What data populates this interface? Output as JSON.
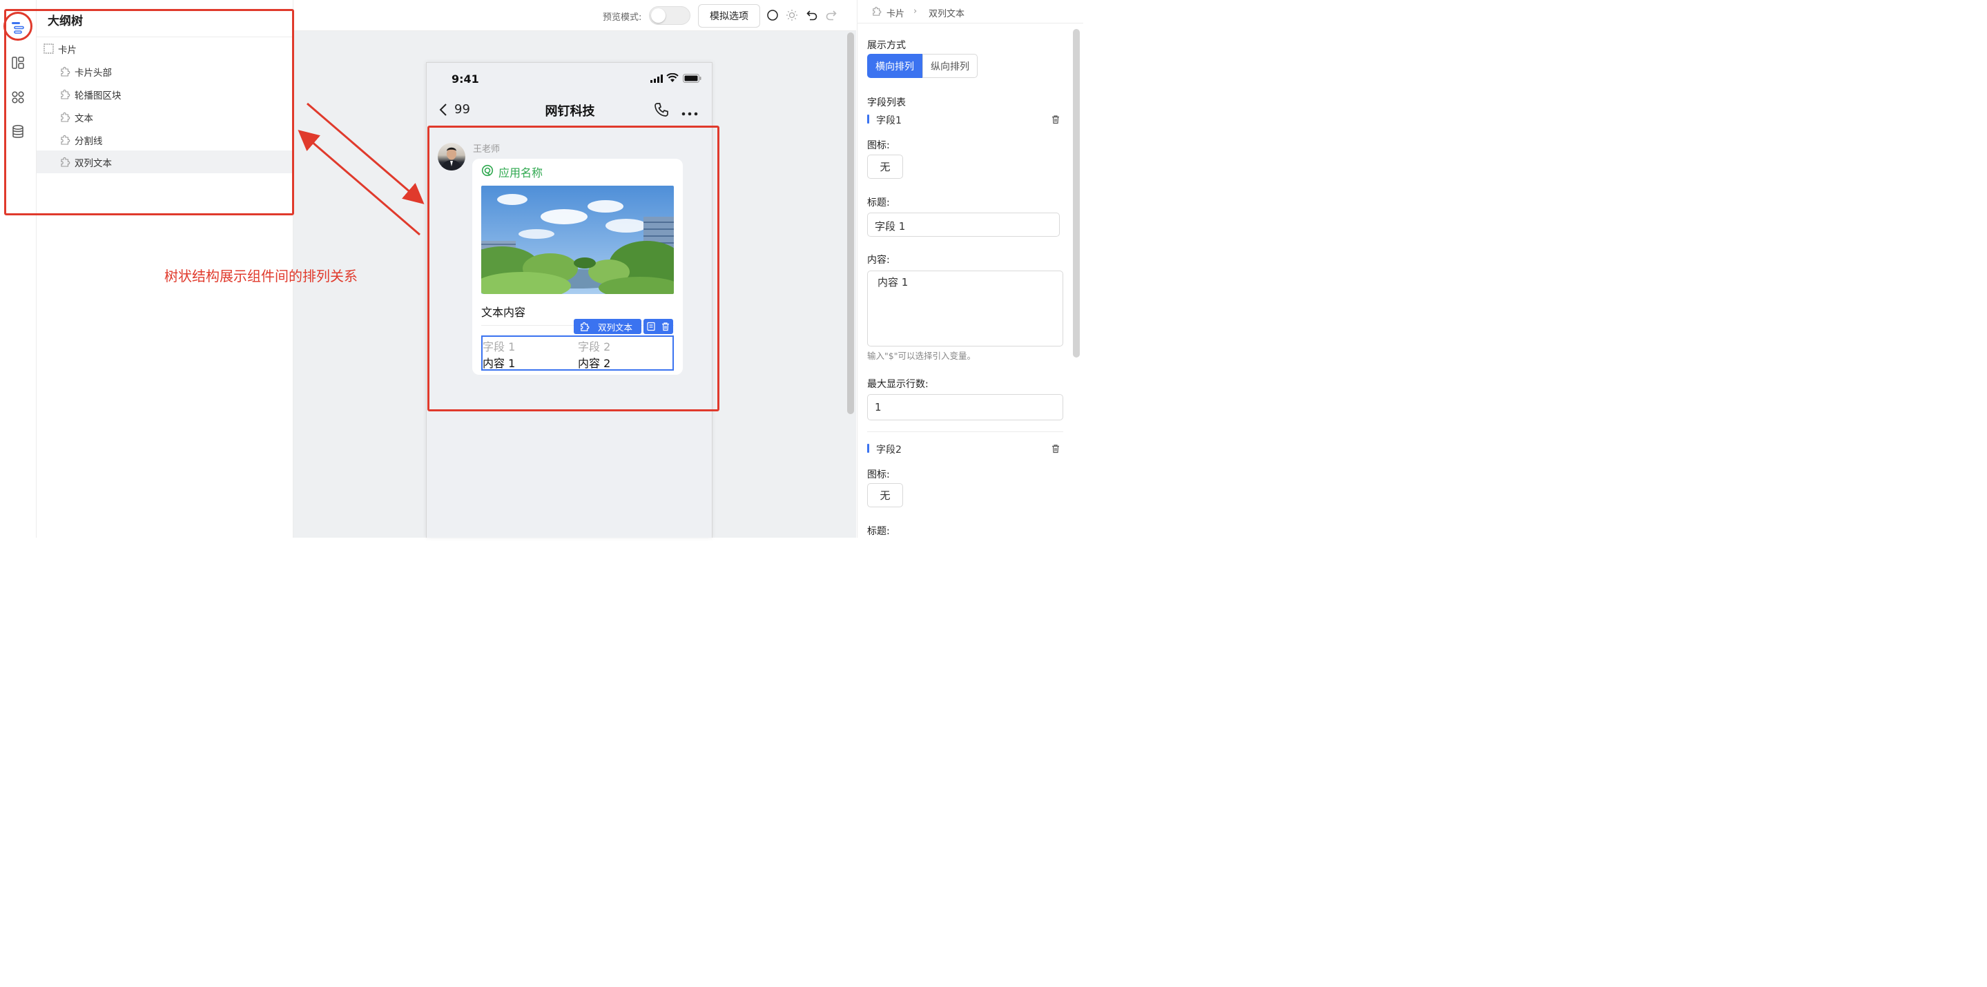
{
  "outline": {
    "title": "大纲树",
    "items": [
      {
        "label": "卡片",
        "icon": "card-icon",
        "level": 0
      },
      {
        "label": "卡片头部",
        "icon": "puzzle-icon",
        "level": 1
      },
      {
        "label": "轮播图区块",
        "icon": "puzzle-icon",
        "level": 1
      },
      {
        "label": "文本",
        "icon": "puzzle-icon",
        "level": 1
      },
      {
        "label": "分割线",
        "icon": "puzzle-icon",
        "level": 1
      },
      {
        "label": "双列文本",
        "icon": "puzzle-icon",
        "level": 1,
        "selected": true
      }
    ]
  },
  "rail": {
    "icons": [
      "outline-tree-icon",
      "layout-icon",
      "components-icon",
      "database-icon"
    ]
  },
  "toolbar": {
    "preview_label": "预览模式:",
    "preview_on": false,
    "simulate_button": "模拟选项"
  },
  "phone": {
    "time": "9:41",
    "back_count": "99",
    "chat_title": "网钉科技",
    "sender": "王老师",
    "card": {
      "app_name": "应用名称",
      "text_content": "文本内容",
      "component_tag": "双列文本",
      "fields": [
        {
          "label": "字段 1",
          "value": "内容 1"
        },
        {
          "label": "字段 2",
          "value": "内容 2"
        }
      ]
    }
  },
  "annotation": {
    "text": "树状结构展示组件间的排列关系",
    "color": "#e03a2c"
  },
  "props": {
    "breadcrumb": [
      "卡片",
      "双列文本"
    ],
    "display_mode_label": "展示方式",
    "display_modes": [
      "横向排列",
      "纵向排列"
    ],
    "display_mode_selected": "横向排列",
    "field_list_label": "字段列表",
    "field1": {
      "name": "字段1",
      "icon_label": "图标:",
      "icon_value": "无",
      "title_label": "标题:",
      "title_value": "字段 1",
      "content_label": "内容:",
      "content_value": "内容 1",
      "hint": "输入\"$\"可以选择引入变量。",
      "max_lines_label": "最大显示行数:",
      "max_lines_value": "1"
    },
    "field2": {
      "name": "字段2",
      "icon_label": "图标:",
      "icon_value": "无",
      "title_label": "标题:"
    }
  },
  "colors": {
    "accent": "#3b73f0",
    "app_green": "#2fa84f",
    "annotation_red": "#e03a2c"
  }
}
